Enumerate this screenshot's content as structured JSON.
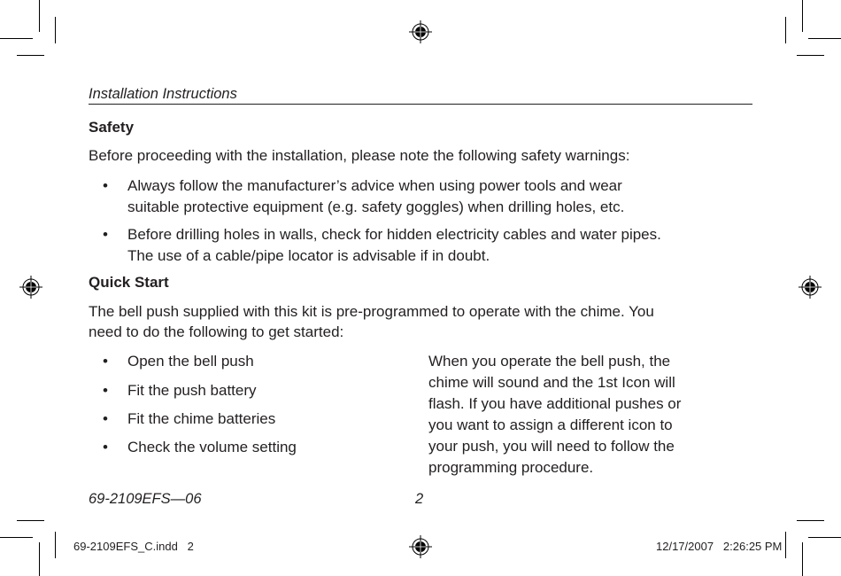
{
  "running_head": "Installation Instructions",
  "safety": {
    "heading": "Safety",
    "intro": "Before proceeding with the installation, please note the following safety warnings:",
    "bullets": [
      {
        "lines": [
          "Always follow the manufacturer’s advice when using power tools and wear",
          "suitable protective equipment (e.g. safety goggles) when drilling holes, etc."
        ]
      },
      {
        "lines": [
          "Before drilling holes in walls, check for hidden electricity cables and water pipes.",
          "The use of a cable/pipe locator is advisable if in doubt."
        ]
      }
    ]
  },
  "quick_start": {
    "heading": "Quick Start",
    "intro_lines": [
      "The bell push supplied with this kit is pre-programmed to operate with the chime. You",
      "need to do the following to get started:"
    ],
    "steps": [
      "Open the bell push",
      "Fit the push battery",
      "Fit the chime batteries",
      "Check the volume setting"
    ],
    "note_lines": [
      "When you operate the bell push, the",
      "chime will sound and the 1st Icon will",
      "flash. If you have additional pushes or",
      "you want to assign a different icon to",
      "your push, you will need to follow the",
      "programming procedure."
    ]
  },
  "bullet_glyph": "•",
  "footer": {
    "doc_number": "69-2109EFS—06",
    "page_number": "2"
  },
  "slug": {
    "file": "69-2109EFS_C.indd   2",
    "timestamp": "12/17/2007   2:26:25 PM"
  }
}
